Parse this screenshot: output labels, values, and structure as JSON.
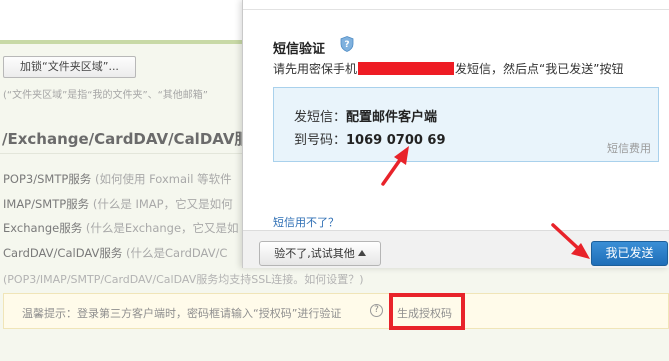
{
  "background": {
    "folder_button_label": "加锁“文件夹区域”...",
    "folder_note": "(“文件夹区域”是指“我的文件夹”、“其他邮箱”",
    "section_heading": "/Exchange/CardDAV/CalDAV服",
    "services": [
      {
        "name": "POP3/SMTP服务",
        "note": "(如何使用 Foxmail 等软件"
      },
      {
        "name": "IMAP/SMTP服务",
        "note": "(什么是 IMAP，它又是如何"
      },
      {
        "name": "Exchange服务",
        "note": "(什么是Exchange，它又是如"
      },
      {
        "name": "CardDAV/CalDAV服务",
        "note": "(什么是CardDAV/C"
      }
    ],
    "ssl_note": "(POP3/IMAP/SMTP/CardDAV/CalDAV服务均支持SSL连接。如何设置？)",
    "tip_text": "温馨提示：登录第三方客户端时，密码框请输入“授权码”进行验证",
    "tip_help": "?",
    "tip_link": "生成授权码"
  },
  "dialog": {
    "title": "短信验证",
    "instruction_prefix": "请先用密保手机",
    "instruction_suffix": "发短信，然后点“我已发送”按钮",
    "sms_content_label": "发短信：",
    "sms_content_value": "配置邮件客户端",
    "sms_number_label": "到号码：",
    "sms_number_value": "1069 0700 69",
    "fee_note": "短信费用",
    "cant_use_link": "短信用不了？",
    "try_other_button": "验不了,试试其他",
    "sent_button": "我已发送"
  },
  "colors": {
    "accent_blue": "#2a7fcc",
    "annotation_red": "#e8232a",
    "sms_box_bg": "#e9f4fb"
  }
}
